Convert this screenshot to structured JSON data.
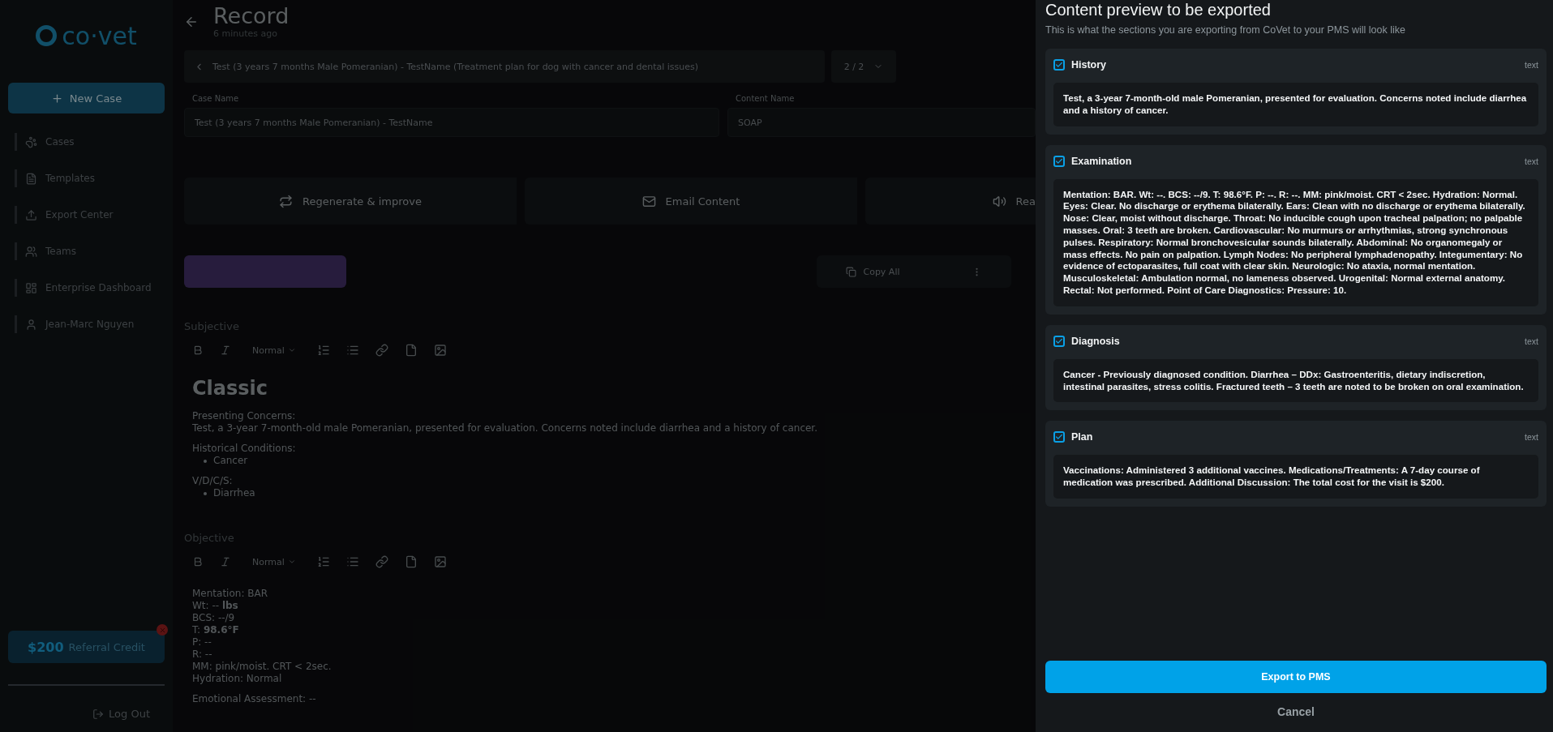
{
  "sidebar": {
    "logo": "co·vet",
    "new_case": "New Case",
    "nav": [
      {
        "label": "Cases"
      },
      {
        "label": "Templates"
      },
      {
        "label": "Export Center"
      },
      {
        "label": "Teams"
      },
      {
        "label": "Enterprise Dashboard"
      },
      {
        "label": "Jean-Marc Nguyen"
      }
    ],
    "referral": {
      "amount": "$200",
      "label": "Referral Credit"
    },
    "log_out": "Log Out"
  },
  "header": {
    "title": "Record",
    "subtitle": "6 minutes ago"
  },
  "breadcrumb": {
    "text": "Test (3 years 7 months Male Pomeranian) - TestName (Treatment plan for dog with cancer and dental issues)",
    "pager": "2 / 2"
  },
  "fields": [
    {
      "label": "Case Name",
      "value": "Test (3 years 7 months Male Pomeranian) - TestName"
    },
    {
      "label": "Content Name",
      "value": "SOAP"
    }
  ],
  "actions": [
    {
      "label": "Regenerate & improve"
    },
    {
      "label": "Email Content"
    },
    {
      "label": "Rea"
    }
  ],
  "copy_all": "Copy All",
  "editors": [
    {
      "title": "Subjective",
      "format": "Normal",
      "blocks": [
        {
          "kind": "heading",
          "text": "Classic"
        },
        {
          "kind": "line",
          "text": "Presenting Concerns:"
        },
        {
          "kind": "line",
          "text": "Test, a 3-year 7-month-old male Pomeranian, presented for evaluation. Concerns noted include diarrhea and a history of cancer."
        },
        {
          "kind": "gap"
        },
        {
          "kind": "line",
          "text": "Historical Conditions:"
        },
        {
          "kind": "bullet",
          "text": "Cancer"
        },
        {
          "kind": "gap"
        },
        {
          "kind": "line",
          "text": "V/D/C/S:"
        },
        {
          "kind": "bullet",
          "text": "Diarrhea"
        }
      ]
    },
    {
      "title": "Objective",
      "format": "Normal",
      "blocks": [
        {
          "kind": "line",
          "text": "Mentation: BAR"
        },
        {
          "kind": "line",
          "text": "Wt: -- **lbs**"
        },
        {
          "kind": "line",
          "text": "BCS: --/9"
        },
        {
          "kind": "line",
          "text": "T: **98.6°F**"
        },
        {
          "kind": "line",
          "text": "P: --"
        },
        {
          "kind": "line",
          "text": "R: --"
        },
        {
          "kind": "line",
          "text": "MM: pink/moist. CRT < 2sec."
        },
        {
          "kind": "line",
          "text": "Hydration: Normal"
        },
        {
          "kind": "gap"
        },
        {
          "kind": "line",
          "text": "Emotional Assessment: --"
        }
      ]
    }
  ],
  "drawer": {
    "title": "Content preview to be exported",
    "subtitle": "This is what the sections you are exporting from CoVet to your PMS will look like",
    "sections": [
      {
        "title": "History",
        "checked": true,
        "type": "text",
        "body": "Test, a 3-year 7-month-old male Pomeranian, presented for evaluation. Concerns noted include diarrhea and a history of cancer."
      },
      {
        "title": "Examination",
        "checked": true,
        "type": "text",
        "body": "Mentation: BAR. Wt: --. BCS: --/9. T: 98.6°F. P: --. R: --. MM: pink/moist. CRT < 2sec. Hydration: Normal. Eyes: Clear. No discharge or erythema bilaterally. Ears: Clean with no discharge or erythema bilaterally. Nose: Clear, moist without discharge. Throat: No inducible cough upon tracheal palpation; no palpable masses. Oral: 3 teeth are broken. Cardiovascular: No murmurs or arrhythmias, strong synchronous pulses. Respiratory: Normal bronchovesicular sounds bilaterally. Abdominal: No organomegaly or mass effects. No pain on palpation. Lymph Nodes: No peripheral lymphadenopathy. Integumentary: No evidence of ectoparasites, full coat with clear skin. Neurologic: No ataxia, normal mentation. Musculoskeletal: Ambulation normal, no lameness observed. Urogenital: Normal external anatomy. Rectal: Not performed. Point of Care Diagnostics: Pressure: 10."
      },
      {
        "title": "Diagnosis",
        "checked": true,
        "type": "text",
        "body": "Cancer - Previously diagnosed condition. Diarrhea – DDx: Gastroenteritis, dietary indiscretion, intestinal parasites, stress colitis. Fractured teeth – 3 teeth are noted to be broken on oral examination."
      },
      {
        "title": "Plan",
        "checked": true,
        "type": "text",
        "body": "Vaccinations: Administered 3 additional vaccines. Medications/Treatments: A 7-day course of medication was prescribed. Additional Discussion: The total cost for the visit is $200."
      }
    ],
    "export": "Export to PMS",
    "cancel": "Cancel"
  }
}
